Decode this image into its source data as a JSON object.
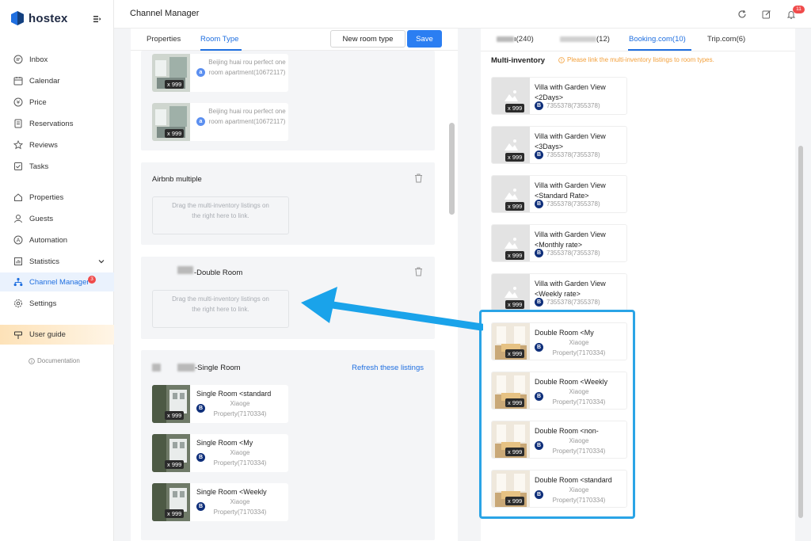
{
  "app": {
    "name": "hostex"
  },
  "sidebar": {
    "items": [
      {
        "label": "Inbox",
        "icon": "inbox-icon"
      },
      {
        "label": "Calendar",
        "icon": "calendar-icon"
      },
      {
        "label": "Price",
        "icon": "price-icon"
      },
      {
        "label": "Reservations",
        "icon": "reservations-icon"
      },
      {
        "label": "Reviews",
        "icon": "star-icon"
      },
      {
        "label": "Tasks",
        "icon": "checkbox-icon"
      },
      {
        "label": "Properties",
        "icon": "home-icon"
      },
      {
        "label": "Guests",
        "icon": "user-icon"
      },
      {
        "label": "Automation",
        "icon": "automation-icon"
      },
      {
        "label": "Statistics",
        "icon": "chart-icon"
      },
      {
        "label": "Channel Manager",
        "icon": "channel-icon",
        "badge": "3"
      },
      {
        "label": "Settings",
        "icon": "gear-icon"
      }
    ],
    "user_guide": "User guide",
    "documentation": "Documentation"
  },
  "topbar": {
    "title": "Channel Manager",
    "notification_count": "11"
  },
  "left": {
    "tabs": [
      "Properties",
      "Room Type"
    ],
    "new_room_type": "New room type",
    "save": "Save",
    "airbnb_cards": [
      {
        "text": "Beijing huai rou perfect one room apartment(10672117)",
        "qty": "x 999"
      },
      {
        "text": "Beijing huai rou perfect one room apartment(10672117)",
        "qty": "x 999"
      }
    ],
    "groups": [
      {
        "title": "Airbnb multiple",
        "dropzone": "Drag the multi-inventory listings on the right here to link."
      },
      {
        "title": "-Double Room",
        "dropzone": "Drag the multi-inventory listings on the right here to link."
      },
      {
        "title": "-Single Room",
        "refresh": "Refresh these listings"
      }
    ],
    "single_cards": [
      {
        "title": "Single Room <standard",
        "sub1": "Xiaoge",
        "sub2": "Property(7170334)",
        "qty": "x 999"
      },
      {
        "title": "Single Room <My",
        "sub1": "Xiaoge",
        "sub2": "Property(7170334)",
        "qty": "x 999"
      },
      {
        "title": "Single Room <Weekly",
        "sub1": "Xiaoge",
        "sub2": "Property(7170334)",
        "qty": "x 999"
      }
    ]
  },
  "right": {
    "tabs": [
      {
        "label": "ı(240)"
      },
      {
        "label": "(12)"
      },
      {
        "label": "Booking.com(10)"
      },
      {
        "label": "Trip.com(6)"
      }
    ],
    "multi_inventory": "Multi-inventory",
    "warning": "Please link the multi-inventory listings to room types.",
    "villa_cards": [
      {
        "title": "Villa with Garden View <2Days>",
        "id": "7355378(7355378)",
        "qty": "x 999"
      },
      {
        "title": "Villa with Garden View <3Days>",
        "id": "7355378(7355378)",
        "qty": "x 999"
      },
      {
        "title": "Villa with Garden View <Standard Rate>",
        "id": "7355378(7355378)",
        "qty": "x 999"
      },
      {
        "title": "Villa with Garden View <Monthly rate>",
        "id": "7355378(7355378)",
        "qty": "x 999"
      },
      {
        "title": "Villa with Garden View <Weekly rate>",
        "id": "7355378(7355378)",
        "qty": "x 999"
      }
    ],
    "double_cards": [
      {
        "title": "Double Room <My",
        "sub1": "Xiaoge",
        "sub2": "Property(7170334)",
        "qty": "x 999"
      },
      {
        "title": "Double Room <Weekly",
        "sub1": "Xiaoge",
        "sub2": "Property(7170334)",
        "qty": "x 999"
      },
      {
        "title": "Double Room <non-",
        "sub1": "Xiaoge",
        "sub2": "Property(7170334)",
        "qty": "x 999"
      },
      {
        "title": "Double Room <standard",
        "sub1": "Xiaoge",
        "sub2": "Property(7170334)",
        "qty": "x 999"
      }
    ]
  },
  "colors": {
    "accent": "#2b7ef2",
    "highlight": "#2aa4e6",
    "booking": "#0f2f7a",
    "airbnb_logo": "#5b8ff0",
    "warning": "#f3a03b",
    "badge": "#f04b4b"
  }
}
